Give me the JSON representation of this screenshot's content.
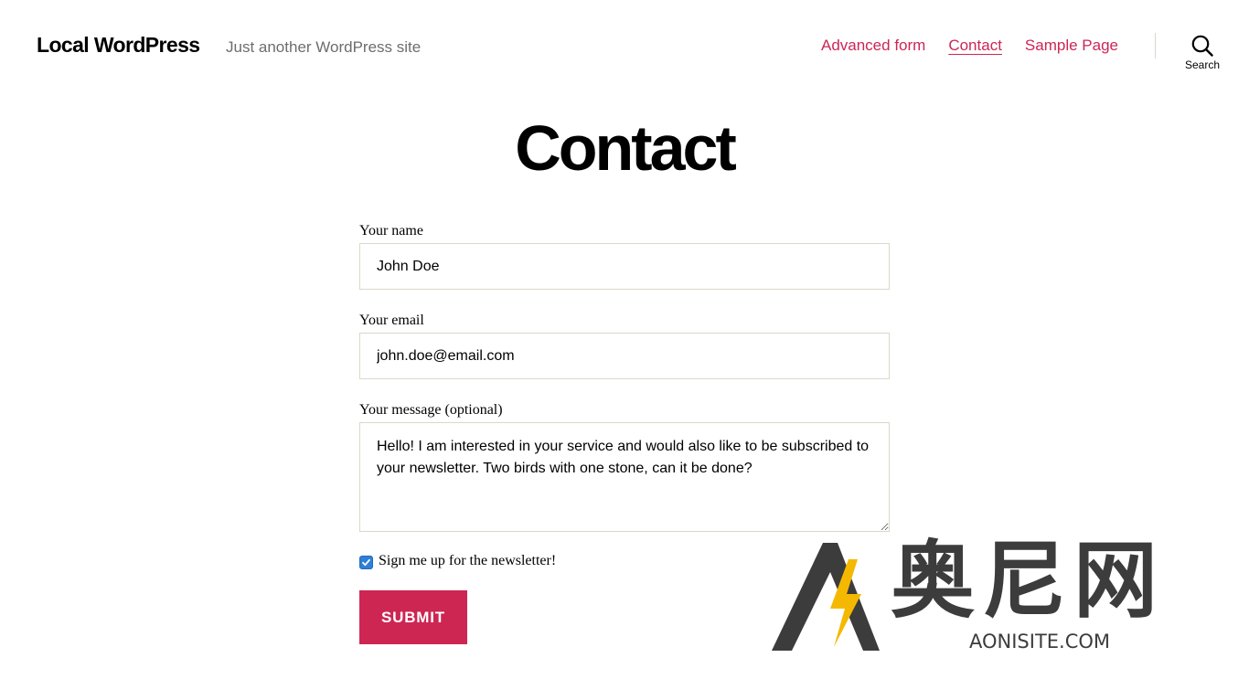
{
  "header": {
    "site_title": "Local WordPress",
    "tagline": "Just another WordPress site",
    "nav": [
      {
        "label": "Advanced form",
        "current": false
      },
      {
        "label": "Contact",
        "current": true
      },
      {
        "label": "Sample Page",
        "current": false
      }
    ],
    "search_label": "Search",
    "search_icon": "search-icon"
  },
  "page": {
    "title": "Contact"
  },
  "form": {
    "name_label": "Your name",
    "name_value": "John Doe",
    "email_label": "Your email",
    "email_value": "john.doe@email.com",
    "message_label": "Your message (optional)",
    "message_value": "Hello! I am interested in your service and would also like to be subscribed to your newsletter. Two birds with one stone, can it be done?",
    "newsletter_label": "Sign me up for the newsletter!",
    "newsletter_checked": true,
    "submit_label": "SUBMIT"
  },
  "watermark": {
    "chinese": "奥尼网",
    "english": "AONISITE.COM"
  },
  "colors": {
    "accent": "#cd2653",
    "tagline": "#6d6d6d",
    "border": "#dcd7ca",
    "checkbox": "#2f7fd6",
    "watermark_gray": "#3c3c3c",
    "watermark_yellow": "#f5b800"
  }
}
